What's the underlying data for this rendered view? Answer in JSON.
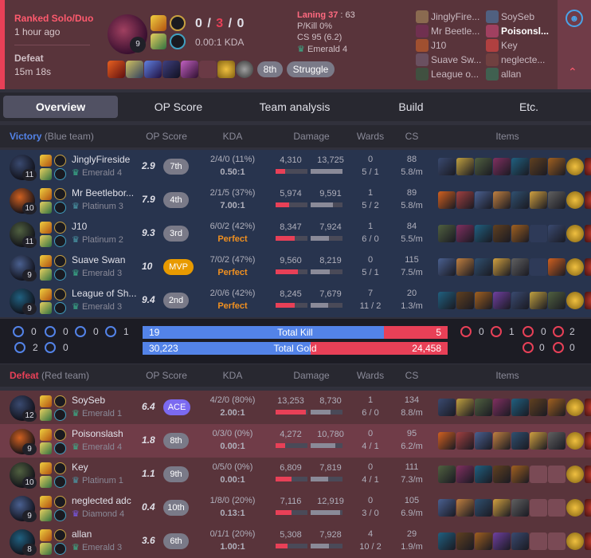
{
  "summary": {
    "queue_type": "Ranked Solo/Duo",
    "time_ago": "1 hour ago",
    "result": "Defeat",
    "duration": "15m 18s",
    "champion_level": "9",
    "kills": "0",
    "sep1": "/",
    "deaths": "3",
    "sep2": "/",
    "assists": "0",
    "kda_ratio": "0.00:1 KDA",
    "placement_badge": "8th",
    "tag_badge": "Struggle",
    "laning_label": "Laning 37",
    "laning_score": " : 63",
    "pkill": "P/Kill 0%",
    "cs": "CS 95 (6.2)",
    "rank": "Emerald 4"
  },
  "participants_blue": [
    "JinglyFire...",
    "Mr Beetle...",
    "J10",
    "Suave Sw...",
    "League o..."
  ],
  "participants_red": [
    "SoySeb",
    "Poisonsl...",
    "Key",
    "neglecte...",
    "allan"
  ],
  "tabs": [
    "Overview",
    "OP Score",
    "Team analysis",
    "Build",
    "Etc."
  ],
  "headers": {
    "score": "OP Score",
    "kda": "KDA",
    "damage": "Damage",
    "wards": "Wards",
    "cs": "CS",
    "items": "Items"
  },
  "blue_team": {
    "result": "Victory",
    "label": "(Blue team)",
    "players": [
      {
        "level": "11",
        "name": "JinglyFireside",
        "tier": "Emerald 4",
        "score": "2.9",
        "badge": "7th",
        "kda": "2/4/0 (11%)",
        "ratio": "0.50:1",
        "dmg": "4,310",
        "taken": "13,725",
        "dmg_pct": 0.31,
        "taken_pct": 0.99,
        "wards": "0",
        "wards2": "5 / 1",
        "cs": "88",
        "cspm": "5.8/m"
      },
      {
        "level": "10",
        "name": "Mr Beetlebor...",
        "tier": "Platinum 3",
        "score": "7.9",
        "badge": "4th",
        "kda": "2/1/5 (37%)",
        "ratio": "7.00:1",
        "dmg": "5,974",
        "taken": "9,591",
        "dmg_pct": 0.43,
        "taken_pct": 0.69,
        "wards": "1",
        "wards2": "5 / 2",
        "cs": "89",
        "cspm": "5.8/m"
      },
      {
        "level": "11",
        "name": "J10",
        "tier": "Platinum 2",
        "score": "9.3",
        "badge": "3rd",
        "kda": "6/0/2 (42%)",
        "ratio": "Perfect",
        "dmg": "8,347",
        "taken": "7,924",
        "dmg_pct": 0.6,
        "taken_pct": 0.57,
        "wards": "1",
        "wards2": "6 / 0",
        "cs": "84",
        "cspm": "5.5/m"
      },
      {
        "level": "9",
        "name": "Suave Swan",
        "tier": "Emerald 3",
        "score": "10",
        "badge": "MVP",
        "kda": "7/0/2 (47%)",
        "ratio": "Perfect",
        "dmg": "9,560",
        "taken": "8,219",
        "dmg_pct": 0.69,
        "taken_pct": 0.59,
        "wards": "0",
        "wards2": "5 / 1",
        "cs": "115",
        "cspm": "7.5/m"
      },
      {
        "level": "9",
        "name": "League of Sh...",
        "tier": "Emerald 3",
        "score": "9.4",
        "badge": "2nd",
        "kda": "2/0/6 (42%)",
        "ratio": "Perfect",
        "dmg": "8,245",
        "taken": "7,679",
        "dmg_pct": 0.59,
        "taken_pct": 0.55,
        "wards": "7",
        "wards2": "11 / 2",
        "cs": "20",
        "cspm": "1.3/m"
      }
    ]
  },
  "objectives": {
    "blue_baron": "0",
    "blue_dragon": "0",
    "blue_herald": "0",
    "blue_grub": "1",
    "blue_tower": "2",
    "blue_inhib": "0",
    "red_baron": "0",
    "red_dragon": "1",
    "red_herald": "0",
    "red_grub": "2",
    "red_tower": "0",
    "red_inhib": "0",
    "kill_blue": "19",
    "kill_label": "Total Kill",
    "kill_red": "5",
    "gold_blue": "30,223",
    "gold_label": "Total Gold",
    "gold_red": "24,458",
    "kill_blue_frac": 0.79,
    "gold_blue_frac": 0.55
  },
  "red_team": {
    "result": "Defeat",
    "label": "(Red team)",
    "players": [
      {
        "level": "12",
        "name": "SoySeb",
        "tier": "Emerald 1",
        "score": "6.4",
        "badge": "ACE",
        "kda": "4/2/0 (80%)",
        "ratio": "2.00:1",
        "dmg": "13,253",
        "taken": "8,730",
        "dmg_pct": 0.95,
        "taken_pct": 0.63,
        "wards": "1",
        "wards2": "6 / 0",
        "cs": "134",
        "cspm": "8.8/m"
      },
      {
        "level": "9",
        "name": "Poisonslash",
        "tier": "Emerald 4",
        "score": "1.8",
        "badge": "8th",
        "kda": "0/3/0 (0%)",
        "ratio": "0.00:1",
        "dmg": "4,272",
        "taken": "10,780",
        "dmg_pct": 0.31,
        "taken_pct": 0.78,
        "wards": "0",
        "wards2": "4 / 1",
        "cs": "95",
        "cspm": "6.2/m"
      },
      {
        "level": "10",
        "name": "Key",
        "tier": "Platinum 1",
        "score": "1.1",
        "badge": "9th",
        "kda": "0/5/0 (0%)",
        "ratio": "0.00:1",
        "dmg": "6,809",
        "taken": "7,819",
        "dmg_pct": 0.49,
        "taken_pct": 0.56,
        "wards": "0",
        "wards2": "4 / 1",
        "cs": "111",
        "cspm": "7.3/m"
      },
      {
        "level": "9",
        "name": "neglected adc",
        "tier": "Diamond 4",
        "score": "0.4",
        "badge": "10th",
        "kda": "1/8/0 (20%)",
        "ratio": "0.13:1",
        "dmg": "7,116",
        "taken": "12,919",
        "dmg_pct": 0.51,
        "taken_pct": 0.93,
        "wards": "0",
        "wards2": "3 / 0",
        "cs": "105",
        "cspm": "6.9/m"
      },
      {
        "level": "8",
        "name": "allan",
        "tier": "Emerald 3",
        "score": "3.6",
        "badge": "6th",
        "kda": "0/1/1 (20%)",
        "ratio": "1.00:1",
        "dmg": "5,308",
        "taken": "7,928",
        "dmg_pct": 0.38,
        "taken_pct": 0.57,
        "wards": "4",
        "wards2": "10 / 2",
        "cs": "29",
        "cspm": "1.9/m"
      }
    ]
  },
  "colors": {
    "blue": "#5383e8",
    "red": "#e84057",
    "gold": "#e89a00",
    "ace": "#7b6af0"
  }
}
